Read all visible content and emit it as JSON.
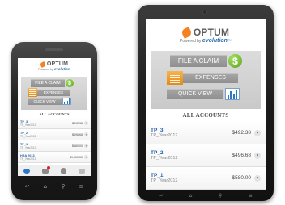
{
  "app": {
    "brand": "OPTUM",
    "powered_by": "Powered by",
    "product": "evolution",
    "trademark": "™"
  },
  "menu": {
    "file_claim": "FILE A CLAIM",
    "expenses": "EXPENSES",
    "quick_view": "QUICK VIEW",
    "dollar_symbol": "$"
  },
  "accounts": {
    "heading": "ALL ACCOUNTS",
    "tablet_rows": [
      {
        "name": "TP_3",
        "year": "TP_Year2012",
        "amount": "$492.38"
      },
      {
        "name": "TP_2",
        "year": "TP_Year2012",
        "amount": "$496.68"
      },
      {
        "name": "TP_1",
        "year": "TP_Year2012",
        "amount": "$580.00"
      }
    ],
    "phone_rows": [
      {
        "name": "TP_3",
        "year": "TP_Year2012",
        "amount": "$492.38"
      },
      {
        "name": "TP_2",
        "year": "TP_Year2012",
        "amount": "$496.68"
      },
      {
        "name": "TP_1",
        "year": "TP_Year2012",
        "amount": "$580.00"
      },
      {
        "name": "HRA 2013",
        "year": "TP_Year2013",
        "amount": "$1,000.00"
      }
    ]
  },
  "colors": {
    "brand_orange": "#f58220",
    "link_blue": "#1f5fa8",
    "dollar_green": "#6cb52d",
    "panel_gray": "#d3d3d3"
  },
  "icons": {
    "dollar": "dollar-icon",
    "expenses": "document-icon",
    "quick_view": "bar-chart-icon",
    "chevron": "chevron-right-icon"
  }
}
